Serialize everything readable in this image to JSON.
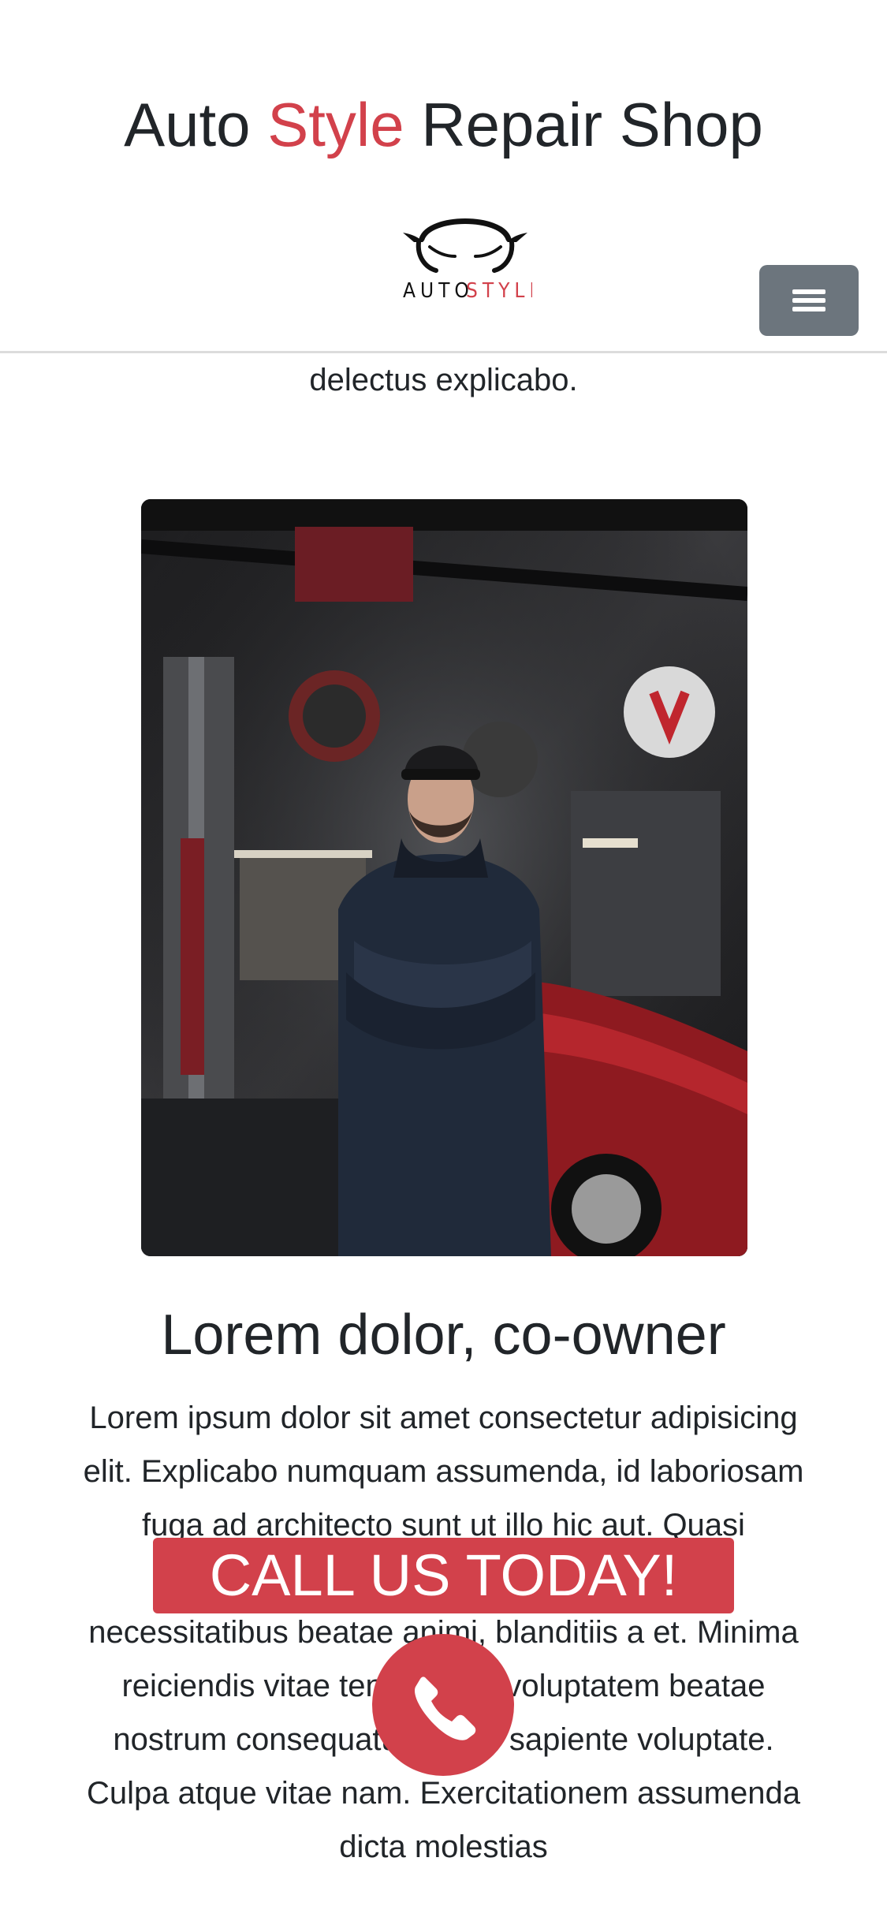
{
  "header": {
    "title_part1": "Auto ",
    "title_accent": "Style",
    "title_part2": " Repair Shop",
    "logo_text_dark": "AUTO",
    "logo_text_accent": "STYLE",
    "menu_icon": "hamburger-icon"
  },
  "content": {
    "text_tail": "delectus explicabo.",
    "photo_alt": "Mechanic standing in garage with arms crossed",
    "person_name": "Lorem dolor, co-owner",
    "bio": "Lorem ipsum dolor sit amet consectetur adipisicing elit. Explicabo numquam assumenda, id laboriosam fuga ad architecto sunt ut illo hic aut. Quasi expedita eum non tempore quidem odio, necessitatibus beatae animi, blanditiis a et. Minima reiciendis vitae tenetur eos voluptatem beatae nostrum consequatur ad illo sapiente voluptate. Culpa atque vitae nam. Exercitationem assumenda dicta molestias"
  },
  "cta": {
    "banner_label": "CALL US TODAY!",
    "call_icon": "phone-icon"
  },
  "colors": {
    "accent": "#d2414b",
    "menu_button": "#6c757d",
    "text": "#212529"
  }
}
